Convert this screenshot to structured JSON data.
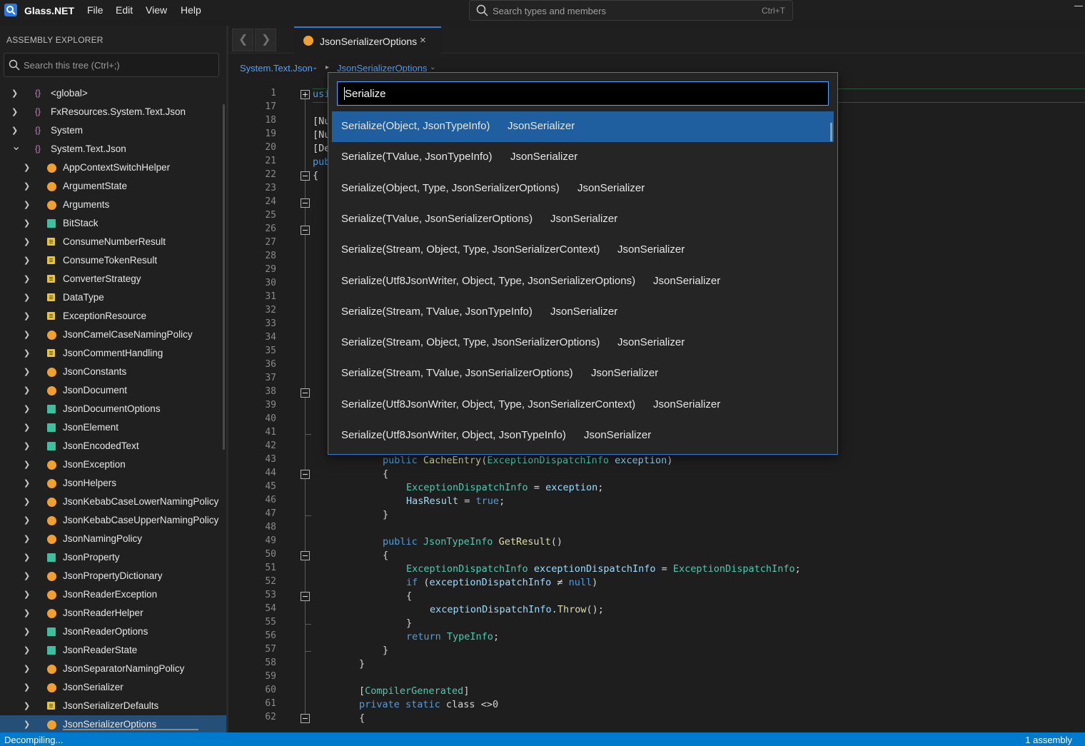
{
  "app": {
    "name": "Glass.NET"
  },
  "menu": [
    "File",
    "Edit",
    "View",
    "Help"
  ],
  "global_search": {
    "placeholder": "Search types and members",
    "shortcut": "Ctrl+T"
  },
  "explorer": {
    "title": "ASSEMBLY EXPLORER",
    "search_placeholder": "Search this tree (Ctrl+;)",
    "namespaces": [
      {
        "label": "<global>",
        "expanded": false
      },
      {
        "label": "FxResources.System.Text.Json",
        "expanded": false
      },
      {
        "label": "System",
        "expanded": false
      },
      {
        "label": "System.Text.Json",
        "expanded": true
      }
    ],
    "types": [
      {
        "label": "AppContextSwitchHelper",
        "kind": "class"
      },
      {
        "label": "ArgumentState",
        "kind": "class"
      },
      {
        "label": "Arguments",
        "kind": "class"
      },
      {
        "label": "BitStack",
        "kind": "struct"
      },
      {
        "label": "ConsumeNumberResult",
        "kind": "enum"
      },
      {
        "label": "ConsumeTokenResult",
        "kind": "enum"
      },
      {
        "label": "ConverterStrategy",
        "kind": "enum"
      },
      {
        "label": "DataType",
        "kind": "enum"
      },
      {
        "label": "ExceptionResource",
        "kind": "enum"
      },
      {
        "label": "JsonCamelCaseNamingPolicy",
        "kind": "class"
      },
      {
        "label": "JsonCommentHandling",
        "kind": "enum"
      },
      {
        "label": "JsonConstants",
        "kind": "class"
      },
      {
        "label": "JsonDocument",
        "kind": "class"
      },
      {
        "label": "JsonDocumentOptions",
        "kind": "struct"
      },
      {
        "label": "JsonElement",
        "kind": "struct"
      },
      {
        "label": "JsonEncodedText",
        "kind": "struct"
      },
      {
        "label": "JsonException",
        "kind": "class"
      },
      {
        "label": "JsonHelpers",
        "kind": "class"
      },
      {
        "label": "JsonKebabCaseLowerNamingPolicy",
        "kind": "class"
      },
      {
        "label": "JsonKebabCaseUpperNamingPolicy",
        "kind": "class"
      },
      {
        "label": "JsonNamingPolicy",
        "kind": "class"
      },
      {
        "label": "JsonProperty",
        "kind": "struct"
      },
      {
        "label": "JsonPropertyDictionary",
        "kind": "class"
      },
      {
        "label": "JsonReaderException",
        "kind": "class"
      },
      {
        "label": "JsonReaderHelper",
        "kind": "class"
      },
      {
        "label": "JsonReaderOptions",
        "kind": "struct"
      },
      {
        "label": "JsonReaderState",
        "kind": "struct"
      },
      {
        "label": "JsonSeparatorNamingPolicy",
        "kind": "class"
      },
      {
        "label": "JsonSerializer",
        "kind": "class"
      },
      {
        "label": "JsonSerializerDefaults",
        "kind": "enum"
      },
      {
        "label": "JsonSerializerOptions",
        "kind": "class",
        "selected": true
      }
    ]
  },
  "tab": {
    "label": "JsonSerializerOptions",
    "close": "×"
  },
  "breadcrumb": [
    "System.Text.Json",
    "JsonSerializerOptions"
  ],
  "editor": {
    "line_numbers": [
      "1",
      "17",
      "18",
      "19",
      "20",
      "21",
      "22",
      "23",
      "24",
      "25",
      "26",
      "27",
      "28",
      "29",
      "30",
      "31",
      "32",
      "33",
      "34",
      "35",
      "36",
      "37",
      "38",
      "39",
      "40",
      "41",
      "42",
      "43",
      "44",
      "45",
      "46",
      "47",
      "48",
      "49",
      "50",
      "51",
      "52",
      "53",
      "54",
      "55",
      "56",
      "57",
      "58",
      "59",
      "60",
      "61",
      "62"
    ],
    "partial_lines": {
      "1": "usi",
      "18": "[Nu",
      "19": "[Nu",
      "20": "[De",
      "21": "pub",
      "22": "{"
    },
    "visible_code": [
      {
        "line": "43",
        "tokens": [
          [
            "kw",
            "public "
          ],
          [
            "fn",
            "CacheEntry"
          ],
          [
            "",
            "("
          ],
          [
            "ty",
            "ExceptionDispatchInfo"
          ],
          [
            "vr",
            " exception"
          ],
          [
            "",
            ")"
          ]
        ]
      },
      {
        "line": "44",
        "tokens": [
          [
            "",
            "{"
          ]
        ]
      },
      {
        "line": "45",
        "tokens": [
          [
            "ty",
            "ExceptionDispatchInfo"
          ],
          [
            "",
            " = "
          ],
          [
            "vr",
            "exception"
          ],
          [
            "",
            ";"
          ]
        ]
      },
      {
        "line": "46",
        "tokens": [
          [
            "vr",
            "HasResult"
          ],
          [
            "",
            " = "
          ],
          [
            "kw",
            "true"
          ],
          [
            "",
            ";"
          ]
        ]
      },
      {
        "line": "47",
        "tokens": [
          [
            "",
            "}"
          ]
        ]
      },
      {
        "line": "49",
        "tokens": [
          [
            "kw",
            "public "
          ],
          [
            "ty",
            "JsonTypeInfo "
          ],
          [
            "fn",
            "GetResult"
          ],
          [
            "",
            "()"
          ]
        ]
      },
      {
        "line": "50",
        "tokens": [
          [
            "",
            "{"
          ]
        ]
      },
      {
        "line": "51",
        "tokens": [
          [
            "ty",
            "ExceptionDispatchInfo "
          ],
          [
            "vr",
            "exceptionDispatchInfo"
          ],
          [
            "",
            " = "
          ],
          [
            "ty",
            "ExceptionDispatchInfo"
          ],
          [
            "",
            ";"
          ]
        ]
      },
      {
        "line": "52",
        "tokens": [
          [
            "kw",
            "if "
          ],
          [
            "",
            "("
          ],
          [
            "vr",
            "exceptionDispatchInfo"
          ],
          [
            "",
            " ≠ "
          ],
          [
            "kw",
            "null"
          ],
          [
            "",
            ")"
          ]
        ]
      },
      {
        "line": "53",
        "tokens": [
          [
            "",
            "{"
          ]
        ]
      },
      {
        "line": "54",
        "tokens": [
          [
            "vr",
            "exceptionDispatchInfo"
          ],
          [
            "",
            "."
          ],
          [
            "fn",
            "Throw"
          ],
          [
            "",
            "();"
          ]
        ]
      },
      {
        "line": "55",
        "tokens": [
          [
            "",
            "}"
          ]
        ]
      },
      {
        "line": "56",
        "tokens": [
          [
            "kw",
            "return "
          ],
          [
            "ty",
            "TypeInfo"
          ],
          [
            "",
            ";"
          ]
        ]
      },
      {
        "line": "57",
        "tokens": [
          [
            "",
            "}"
          ]
        ]
      },
      {
        "line": "58",
        "tokens": [
          [
            "",
            "}"
          ]
        ]
      },
      {
        "line": "60",
        "tokens": [
          [
            "",
            "["
          ],
          [
            "ty",
            "CompilerGenerated"
          ],
          [
            "",
            "]"
          ]
        ]
      },
      {
        "line": "61",
        "tokens": [
          [
            "kw",
            "private static "
          ],
          [
            "",
            "class <>0"
          ]
        ]
      },
      {
        "line": "62",
        "tokens": [
          [
            "",
            "{"
          ]
        ]
      }
    ]
  },
  "popup": {
    "query": "Serialize",
    "results": [
      {
        "signature": "Serialize(Object, JsonTypeInfo)",
        "owner": "JsonSerializer",
        "selected": true
      },
      {
        "signature": "Serialize(TValue, JsonTypeInfo)",
        "owner": "JsonSerializer"
      },
      {
        "signature": "Serialize(Object, Type, JsonSerializerOptions)",
        "owner": "JsonSerializer"
      },
      {
        "signature": "Serialize(TValue, JsonSerializerOptions)",
        "owner": "JsonSerializer"
      },
      {
        "signature": "Serialize(Stream, Object, Type, JsonSerializerContext)",
        "owner": "JsonSerializer"
      },
      {
        "signature": "Serialize(Utf8JsonWriter, Object, Type, JsonSerializerOptions)",
        "owner": "JsonSerializer"
      },
      {
        "signature": "Serialize(Stream, TValue, JsonTypeInfo)",
        "owner": "JsonSerializer"
      },
      {
        "signature": "Serialize(Stream, Object, Type, JsonSerializerOptions)",
        "owner": "JsonSerializer"
      },
      {
        "signature": "Serialize(Stream, TValue, JsonSerializerOptions)",
        "owner": "JsonSerializer"
      },
      {
        "signature": "Serialize(Utf8JsonWriter, Object, Type, JsonSerializerContext)",
        "owner": "JsonSerializer"
      },
      {
        "signature": "Serialize(Utf8JsonWriter, Object, JsonTypeInfo)",
        "owner": "JsonSerializer"
      }
    ]
  },
  "status": {
    "left": "Decompiling...",
    "right": "1 assembly"
  }
}
